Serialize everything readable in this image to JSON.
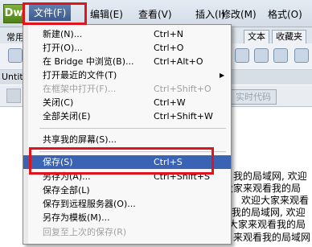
{
  "app": {
    "logo_text": "Dw"
  },
  "menubar": {
    "items": [
      {
        "label": "文件(F)"
      },
      {
        "label": "编辑(E)"
      },
      {
        "label": "查看(V)"
      },
      {
        "label": "插入(I)"
      },
      {
        "label": "修改(M)"
      },
      {
        "label": "格式(O)"
      }
    ]
  },
  "background": {
    "tab_common": "常用",
    "tab_text": "文本",
    "tab_favorites": "收藏夹",
    "doc_tab": "Untit",
    "realtime_code_button": "实时代码",
    "content_lines": [
      "我的局域网, 欢迎",
      "大家来观看我的局",
      "欢迎大家来观看",
      "我的局域网, 欢迎",
      "大家来观看我的局",
      "来观看我的局域网"
    ]
  },
  "file_menu": {
    "items": [
      {
        "label": "新建(N)...",
        "shortcut": "Ctrl+N"
      },
      {
        "label": "打开(O)...",
        "shortcut": "Ctrl+O"
      },
      {
        "label": "在 Bridge 中浏览(B)...",
        "shortcut": "Ctrl+Alt+O"
      },
      {
        "label": "打开最近的文件(T)",
        "shortcut": ""
      },
      {
        "label": "在框架中打开(F)...",
        "shortcut": "Ctrl+Shift+O"
      },
      {
        "label": "关闭(C)",
        "shortcut": "Ctrl+W"
      },
      {
        "label": "全部关闭(E)",
        "shortcut": "Ctrl+Shift+W"
      },
      {
        "label": "共享我的屏幕(S)...",
        "shortcut": ""
      },
      {
        "label": "保存(S)",
        "shortcut": "Ctrl+S"
      },
      {
        "label": "另存为(A)...",
        "shortcut": "Ctrl+Shift+S"
      },
      {
        "label": "保存全部(L)",
        "shortcut": ""
      },
      {
        "label": "保存到远程服务器(O)...",
        "shortcut": ""
      },
      {
        "label": "另存为模板(M)...",
        "shortcut": ""
      },
      {
        "label": "回复至上次的保存(R)",
        "shortcut": ""
      }
    ],
    "submenu_arrow": "▶"
  },
  "colors": {
    "highlight": "#e0141c",
    "selected_bg": "#3a63b3"
  }
}
